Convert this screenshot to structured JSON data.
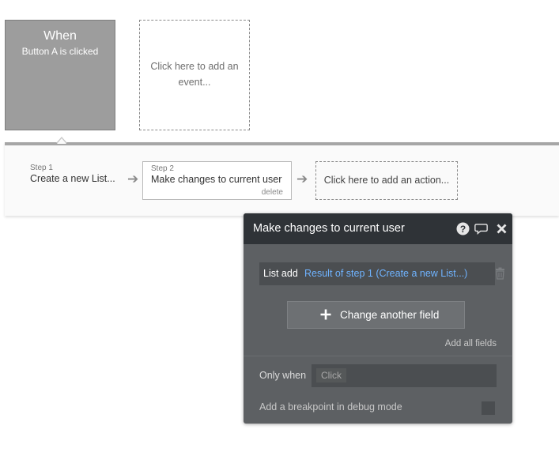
{
  "event": {
    "when": "When",
    "trigger": "Button A is clicked"
  },
  "add_event": {
    "label": "Click here to add an event..."
  },
  "steps": [
    {
      "number": "Step 1",
      "title": "Create a new List..."
    },
    {
      "number": "Step 2",
      "title": "Make changes to current user",
      "delete_label": "delete"
    }
  ],
  "add_action": {
    "label": "Click here to add an action..."
  },
  "panel": {
    "title": "Make changes to current user",
    "icons": [
      "help-icon",
      "comment-icon",
      "close-icon"
    ],
    "field": {
      "label": "List add",
      "value": "Result of step 1 (Create a new List...)"
    },
    "change_button": "Change another field",
    "add_all_fields": "Add all fields",
    "only_when_label": "Only when",
    "only_when_placeholder": "Click",
    "breakpoint_label": "Add a breakpoint in debug mode"
  },
  "colors": {
    "link": "#6fb3ff",
    "panel_bg": "#5d6063",
    "panel_header": "#2f3337",
    "event_card": "#9d9d9d"
  }
}
